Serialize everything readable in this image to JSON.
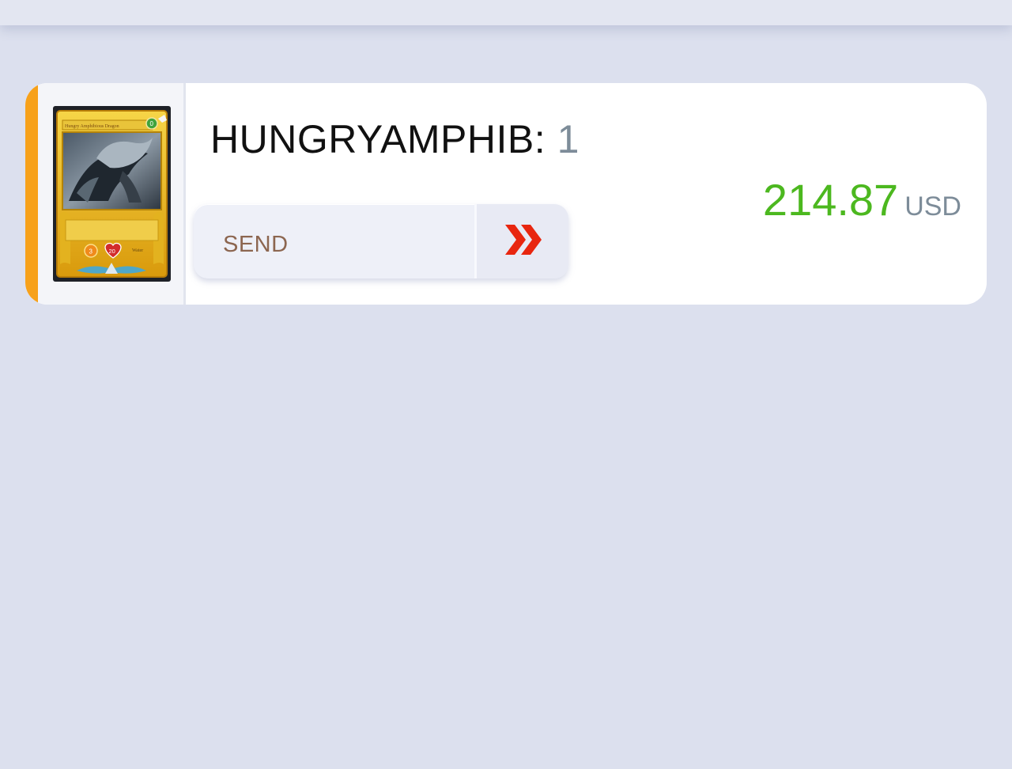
{
  "item": {
    "name": "HUNGRYAMPHIB:",
    "quantity": "1",
    "price": "214.87",
    "currency": "USD",
    "send_label": "SEND",
    "send_icon": "double-chevron-right-icon",
    "card": {
      "title": "Hungry Amphibious Dragon",
      "mana": "0",
      "speed": "3",
      "health": "20",
      "element": "Water"
    }
  },
  "colors": {
    "accent": "#f7a11a",
    "price": "#4cb81f",
    "arrow": "#e8260f"
  }
}
